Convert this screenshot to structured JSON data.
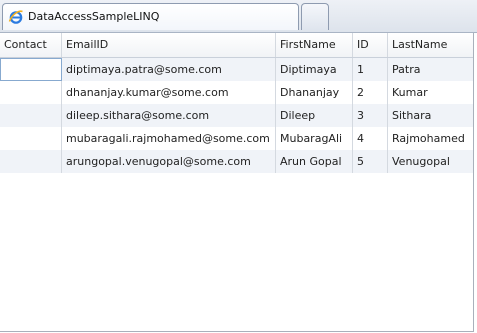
{
  "window": {
    "tab_title": "DataAccessSampleLINQ",
    "tab_icon": "internet-explorer-icon"
  },
  "grid": {
    "columns": [
      "Contact",
      "EmailID",
      "FirstName",
      "ID",
      "LastName"
    ],
    "rows": [
      {
        "contact": "",
        "email": "diptimaya.patra@some.com",
        "first": "Diptimaya",
        "id": "1",
        "last": "Patra"
      },
      {
        "contact": "",
        "email": "dhananjay.kumar@some.com",
        "first": "Dhananjay",
        "id": "2",
        "last": "Kumar"
      },
      {
        "contact": "",
        "email": "dileep.sithara@some.com",
        "first": "Dileep",
        "id": "3",
        "last": "Sithara"
      },
      {
        "contact": "",
        "email": "mubaragali.rajmohamed@some.com",
        "first": "MubaragAli",
        "id": "4",
        "last": "Rajmohamed"
      },
      {
        "contact": "",
        "email": "arungopal.venugopal@some.com",
        "first": "Arun Gopal",
        "id": "5",
        "last": "Venugopal"
      }
    ]
  },
  "colors": {
    "alt_row": "#f0f3f8",
    "selection_border": "#87a9cf",
    "tab_border": "#8e9bb0"
  }
}
